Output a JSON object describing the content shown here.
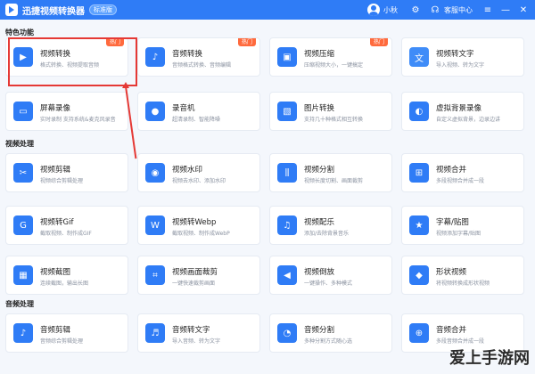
{
  "titlebar": {
    "app_title": "迅捷视频转换器",
    "version_badge": "标准版",
    "username": "小秋",
    "service_label": "客服中心"
  },
  "sections": [
    {
      "title": "特色功能",
      "cards": [
        {
          "name": "视频转换",
          "desc": "格式转换、视频提取音频",
          "hot": "热门",
          "icon": "video-convert-icon",
          "color": "#2f7cf6"
        },
        {
          "name": "音频转换",
          "desc": "音频格式转换、音频编辑",
          "hot": "热门",
          "icon": "audio-convert-icon",
          "color": "#2f7cf6"
        },
        {
          "name": "视频压缩",
          "desc": "压缩视频大小，一键搞定",
          "hot": "热门",
          "icon": "video-compress-icon",
          "color": "#2f7cf6"
        },
        {
          "name": "视频转文字",
          "desc": "导入视频、转为文字",
          "hot": "",
          "icon": "video-to-text-icon",
          "color": "#3f8cf8"
        },
        {
          "name": "屏幕录像",
          "desc": "实时录制 支持系统&麦克风录音",
          "hot": "",
          "icon": "screen-record-icon",
          "color": "#2f7cf6"
        },
        {
          "name": "录音机",
          "desc": "超清录制、智能降噪",
          "hot": "",
          "icon": "recorder-icon",
          "color": "#2f7cf6"
        },
        {
          "name": "图片转换",
          "desc": "支持几十种格式相互转换",
          "hot": "",
          "icon": "image-convert-icon",
          "color": "#2f7cf6"
        },
        {
          "name": "虚拟背景录像",
          "desc": "自定义虚拟背景，边录边讲",
          "hot": "",
          "icon": "virtual-bg-icon",
          "color": "#2f7cf6"
        }
      ]
    },
    {
      "title": "视频处理",
      "cards": [
        {
          "name": "视频剪辑",
          "desc": "视频综合剪辑处理",
          "hot": "",
          "icon": "video-edit-icon",
          "color": "#2f7cf6"
        },
        {
          "name": "视频水印",
          "desc": "视频去水印、添加水印",
          "hot": "",
          "icon": "watermark-icon",
          "color": "#2f7cf6"
        },
        {
          "name": "视频分割",
          "desc": "视频长度切割、画面裁剪",
          "hot": "",
          "icon": "video-split-icon",
          "color": "#2f7cf6"
        },
        {
          "name": "视频合并",
          "desc": "多段视频合并成一段",
          "hot": "",
          "icon": "video-merge-icon",
          "color": "#2f7cf6"
        },
        {
          "name": "视频转Gif",
          "desc": "截取视频、制作成GIF",
          "hot": "",
          "icon": "gif-icon",
          "color": "#2f7cf6"
        },
        {
          "name": "视频转Webp",
          "desc": "截取视频、制作成WebP",
          "hot": "",
          "icon": "webp-icon",
          "color": "#2f7cf6"
        },
        {
          "name": "视频配乐",
          "desc": "添加/去除背景音乐",
          "hot": "",
          "icon": "music-icon",
          "color": "#2f7cf6"
        },
        {
          "name": "字幕/贴图",
          "desc": "视频添加字幕/贴图",
          "hot": "",
          "icon": "subtitle-icon",
          "color": "#2f7cf6"
        },
        {
          "name": "视频截图",
          "desc": "连续截图，输出长图",
          "hot": "",
          "icon": "screenshot-icon",
          "color": "#2f7cf6"
        },
        {
          "name": "视频画面裁剪",
          "desc": "一键快速裁剪画面",
          "hot": "",
          "icon": "crop-icon",
          "color": "#2f7cf6"
        },
        {
          "name": "视频倒放",
          "desc": "一键操作、多种模式",
          "hot": "",
          "icon": "reverse-icon",
          "color": "#2f7cf6"
        },
        {
          "name": "形状视频",
          "desc": "将视频转换成形状视频",
          "hot": "",
          "icon": "shape-icon",
          "color": "#2f7cf6"
        }
      ]
    },
    {
      "title": "音频处理",
      "cards": [
        {
          "name": "音频剪辑",
          "desc": "音频综合剪辑处理",
          "hot": "",
          "icon": "audio-edit-icon",
          "color": "#2f7cf6"
        },
        {
          "name": "音频转文字",
          "desc": "导入音频、转为文字",
          "hot": "",
          "icon": "audio-to-text-icon",
          "color": "#2f7cf6"
        },
        {
          "name": "音频分割",
          "desc": "多种分割方式随心选",
          "hot": "",
          "icon": "audio-split-icon",
          "color": "#2f7cf6"
        },
        {
          "name": "音频合并",
          "desc": "多段音频合并成一段",
          "hot": "",
          "icon": "audio-merge-icon",
          "color": "#2f7cf6"
        }
      ]
    }
  ],
  "watermark": "爱上手游网"
}
